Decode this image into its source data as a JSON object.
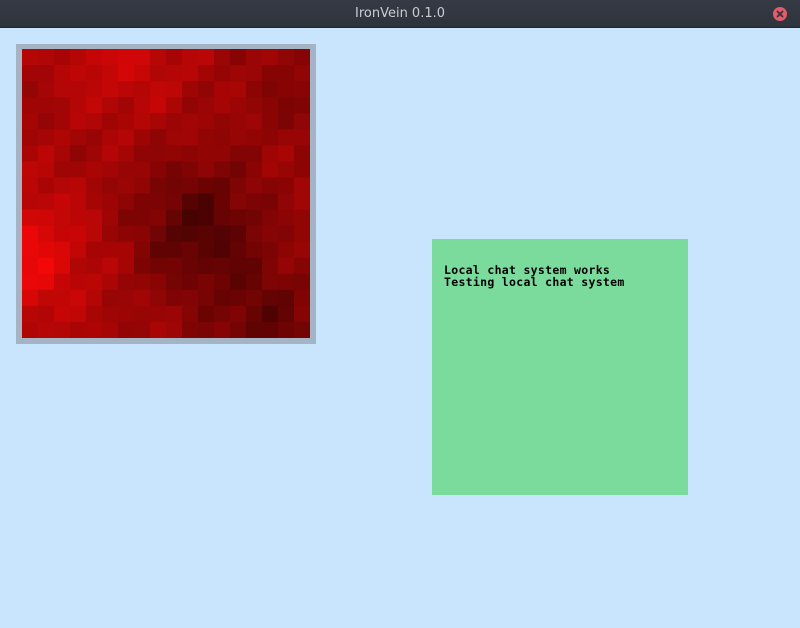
{
  "window": {
    "title": "IronVein 0.1.0",
    "close_icon": "close-icon",
    "background_color": "#c8e5fd",
    "titlebar_color": "#33373f",
    "close_color": "#e25c6c"
  },
  "map": {
    "frame_color": "#a4b4c4",
    "terrain_color": "#c00000",
    "grid_cells": 18
  },
  "chat": {
    "background_color": "#7bdb9c",
    "messages": [
      "Local chat system works",
      "Testing local chat system"
    ]
  }
}
